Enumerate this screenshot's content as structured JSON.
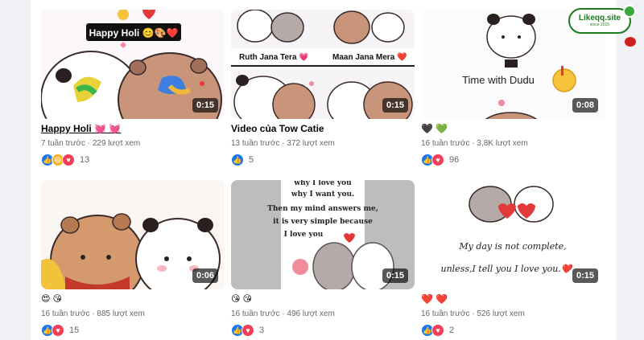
{
  "watermark": {
    "name": "Likeqq.site",
    "sub": "since 2015"
  },
  "videos": [
    {
      "title": "Happy Holi",
      "title_hearts": "💓 💓",
      "duration": "0:15",
      "meta": "7 tuần trước · 229 lượt xem",
      "reaction_count": "13",
      "overlay_text": "Happy Holi 😊🎨❤️"
    },
    {
      "title": "Video của Tow Catie",
      "duration": "0:15",
      "meta": "13 tuần trước · 372 lượt xem",
      "reaction_count": "5",
      "overlay_left": "Ruth Jana Tera 💗",
      "overlay_right": "Maan Jana Mera ❤️"
    },
    {
      "title_hearts_black": "🖤",
      "title_hearts_green": "💚",
      "duration": "0:08",
      "meta": "16 tuần trước · 3,8K lượt xem",
      "reaction_count": "96",
      "overlay_text": "Time with Dudu"
    },
    {
      "title_emoji": "😍 😘",
      "duration": "0:06",
      "meta": "16 tuần trước · 885 lượt xem",
      "reaction_count": "15"
    },
    {
      "title_emoji": "😘 😘",
      "duration": "0:15",
      "meta": "16 tuần trước · 496 lượt xem",
      "reaction_count": "3",
      "overlay_lines": [
        "why I love you",
        "why I want you.",
        "Then my mind answers me,",
        "it is very simple because",
        "I love you"
      ]
    },
    {
      "title_hearts": "❤️ ❤️",
      "duration": "0:15",
      "meta": "16 tuần trước · 526 lượt xem",
      "reaction_count": "2",
      "overlay_lines": [
        "My day is not complete,",
        "unless,I tell you I love you.❤️"
      ]
    }
  ],
  "colors": {
    "accent": "#1877f2",
    "love": "#f33e58",
    "text_secondary": "#65676b"
  }
}
